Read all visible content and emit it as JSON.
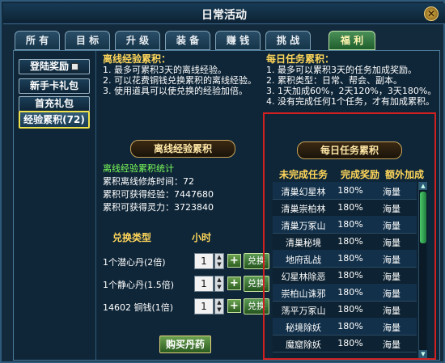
{
  "window": {
    "title": "日常活动",
    "close_glyph": "✕"
  },
  "tabs": [
    {
      "label": "所 有",
      "active": false
    },
    {
      "label": "目 标",
      "active": false
    },
    {
      "label": "升 级",
      "active": false
    },
    {
      "label": "装 备",
      "active": false
    },
    {
      "label": "赚 钱",
      "active": false
    },
    {
      "label": "挑 战",
      "active": false
    },
    {
      "label": "福 利",
      "active": true
    }
  ],
  "sidebar": {
    "items": [
      {
        "label": "登陆奖励",
        "active": false
      },
      {
        "label": "新手卡礼包",
        "active": false
      },
      {
        "label": "首充礼包",
        "active": false
      },
      {
        "label": "经验累积(72)",
        "active": true
      }
    ]
  },
  "info": {
    "offline": {
      "title": "离线经验累积：",
      "lines": [
        "1. 最多可累积3天的离线经验。",
        "2. 可以花费铜钱兑换累积的离线经验。",
        "3. 使用道具可以使兑换的经验加倍。"
      ]
    },
    "daily": {
      "title": "每日任务累积：",
      "lines": [
        "1. 最多可以累积3天的任务加成奖励。",
        "2. 累积类型：日常、帮会、副本。",
        "3. 1天加成60%，2天120%，3天180%。",
        "4. 没有完成任何1个任务，才有加成累积。"
      ]
    }
  },
  "offline_panel": {
    "ribbon": "离线经验累积",
    "stats_title": "离线经验累积统计",
    "stats": [
      "累积离线修炼时间：72",
      "累积可获得经验：7447680",
      "累积可获得灵力：3723840"
    ],
    "header_type": "兑换类型",
    "header_hours": "小时",
    "rows": [
      {
        "name": "1个潜心丹(2倍)",
        "qty": "1",
        "button": "兑换"
      },
      {
        "name": "1个静心丹(1.5倍)",
        "qty": "1",
        "button": "兑换"
      },
      {
        "name": "14602 铜钱(1倍)",
        "qty": "1",
        "button": "兑换"
      }
    ],
    "buy_button": "购买丹药"
  },
  "daily_panel": {
    "ribbon": "每日任务累积",
    "headers": [
      "未完成任务",
      "完成奖励",
      "额外加成"
    ],
    "rows": [
      [
        "清巢幻星林",
        "180%",
        "海量"
      ],
      [
        "清巢崇柏林",
        "180%",
        "海量"
      ],
      [
        "清巢万冢山",
        "180%",
        "海量"
      ],
      [
        "清巢秘境",
        "180%",
        "海量"
      ],
      [
        "地府乱战",
        "180%",
        "海量"
      ],
      [
        "幻星林除恶",
        "180%",
        "海量"
      ],
      [
        "崇柏山诛邪",
        "180%",
        "海量"
      ],
      [
        "荡平万冢山",
        "180%",
        "海量"
      ],
      [
        "秘境除妖",
        "180%",
        "海量"
      ],
      [
        "魔窟除妖",
        "180%",
        "海量"
      ]
    ]
  },
  "icons": {
    "gift": "gift-icon",
    "close": "close-icon",
    "spin_up": "▲",
    "spin_down": "▼",
    "plus": "+"
  },
  "colors": {
    "accent_gold": "#ffd65a",
    "active_tab_green": "#4b8f58",
    "highlight_red": "#d02020",
    "stat_green": "#7cff5a"
  }
}
